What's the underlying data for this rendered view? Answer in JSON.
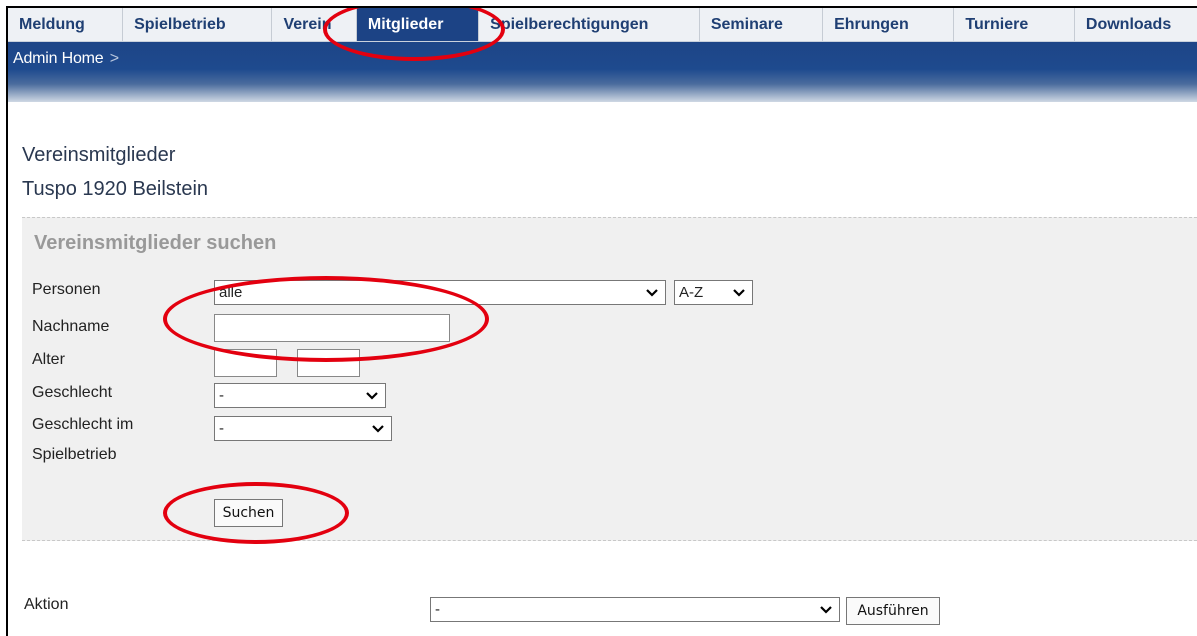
{
  "nav": {
    "tabs": [
      {
        "label": "Meldung"
      },
      {
        "label": "Spielbetrieb"
      },
      {
        "label": "Verein"
      },
      {
        "label": "Mitglieder",
        "active": true
      },
      {
        "label": "Spielberechtigungen"
      },
      {
        "label": "Seminare"
      },
      {
        "label": "Ehrungen"
      },
      {
        "label": "Turniere"
      },
      {
        "label": "Downloads"
      }
    ]
  },
  "breadcrumb": {
    "home": "Admin Home",
    "separator": ">"
  },
  "page": {
    "title": "Vereinsmitglieder",
    "club": "Tuspo 1920 Beilstein"
  },
  "search": {
    "heading": "Vereinsmitglieder suchen",
    "persons_label": "Personen",
    "persons_value": "alle",
    "sort_value": "A-Z",
    "lastname_label": "Nachname",
    "lastname_value": "",
    "age_label": "Alter",
    "age_separator": "-",
    "age_from": "",
    "age_to": "",
    "gender_label": "Geschlecht",
    "gender_value": "-",
    "gender_play_label_1": "Geschlecht im",
    "gender_play_label_2": "Spielbetrieb",
    "gender_play_value": "-",
    "search_button": "Suchen"
  },
  "action": {
    "label": "Aktion",
    "value": "-",
    "button": "Ausführen"
  },
  "colors": {
    "nav_active": "#1c4385",
    "annotation": "#e3000f",
    "panel": "#f0f0f0"
  }
}
